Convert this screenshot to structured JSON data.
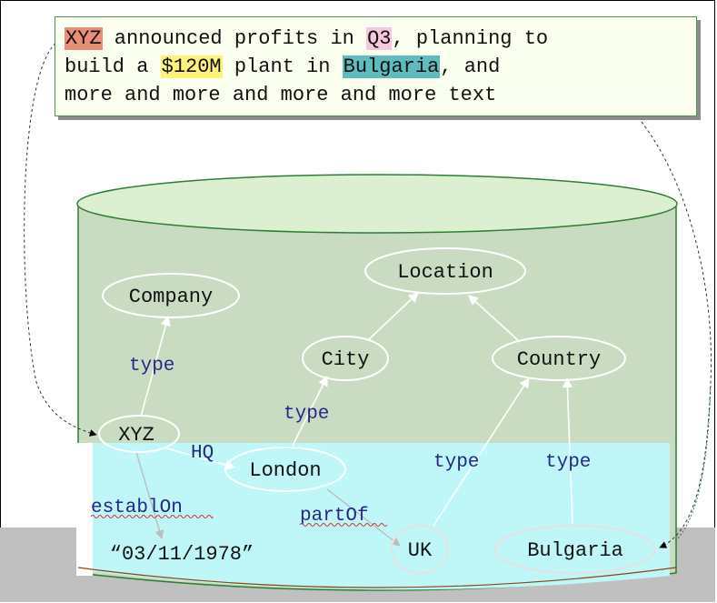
{
  "sentence": {
    "line1": {
      "ent1": "XYZ",
      "t1": " announced profits in ",
      "ent2": "Q3",
      "t2": ", planning to"
    },
    "line2": {
      "t1": "build a ",
      "ent3": "$120M",
      "t2": " plant in ",
      "ent4": "Bulgaria",
      "t3": ",    and"
    },
    "line3": "more and more and more and more text"
  },
  "highlight_colors": {
    "ent1": "#e98f76",
    "ent2": "#f7c7df",
    "ent3": "#fff27a",
    "ent4": "#5fbcbc"
  },
  "nodes": {
    "location": "Location",
    "company": "Company",
    "city": "City",
    "country": "Country",
    "xyz": "XYZ",
    "london": "London",
    "uk": "UK",
    "bulgaria": "Bulgaria",
    "date": "“03/11/1978”"
  },
  "edge_labels": {
    "type_company": "type",
    "type_city": "type",
    "type_country": "type",
    "type_bulgaria": "type",
    "hq": "HQ",
    "establ_on": "establOn",
    "part_of": "partOf"
  },
  "colors": {
    "cylinder_green": "#c9dcc1",
    "cylinder_top": "#dcefd0",
    "cylinder_edge": "#2e7d32",
    "water": "#bff7f9",
    "ground": "#c0c0c0",
    "edge_label": "#26268c"
  }
}
